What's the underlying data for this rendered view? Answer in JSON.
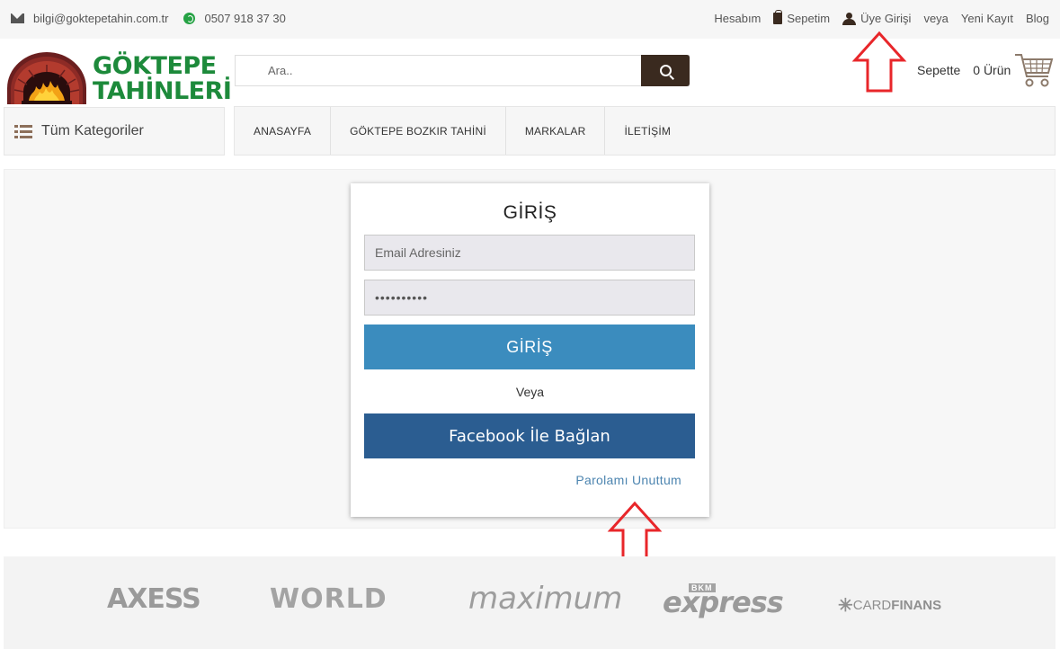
{
  "topbar": {
    "email": "bilgi@goktepetahin.com.tr",
    "phone": "0507 918 37 30",
    "links": {
      "account": "Hesabım",
      "cart": "Sepetim",
      "login": "Üye Girişi",
      "or": "veya",
      "register": "Yeni Kayıt",
      "blog": "Blog"
    }
  },
  "logo": {
    "line1": "GÖKTEPE",
    "line2": "TAHİNLERİ"
  },
  "search": {
    "placeholder": "Ara.."
  },
  "cart": {
    "label": "Sepette",
    "count": "0 Ürün"
  },
  "categories": {
    "label": "Tüm Kategoriler"
  },
  "nav": [
    {
      "label": "ANASAYFA"
    },
    {
      "label": "GÖKTEPE BOZKIR TAHİNİ"
    },
    {
      "label": "MARKALAR"
    },
    {
      "label": "İLETİŞİM"
    }
  ],
  "login": {
    "title": "GİRİŞ",
    "email_placeholder": "Email Adresiniz",
    "password_value": "••••••••••",
    "submit_label": "GİRİŞ",
    "or_label": "Veya",
    "facebook_label": "Facebook İle Bağlan",
    "forgot_label": "Parolamı Unuttum"
  },
  "banks": {
    "axess": "AXESS",
    "world": "WORLD",
    "maximum": "maximum",
    "express": "express",
    "express_sub": "BKM",
    "cardfinans_pre": "CARD",
    "cardfinans_main": "FINANS"
  },
  "colors": {
    "brand_green": "#1d8a3b",
    "brand_brown": "#3a2a1f",
    "login_button": "#3b8cbe",
    "facebook_button": "#2b5d91",
    "annotation_red": "#e8262a"
  }
}
